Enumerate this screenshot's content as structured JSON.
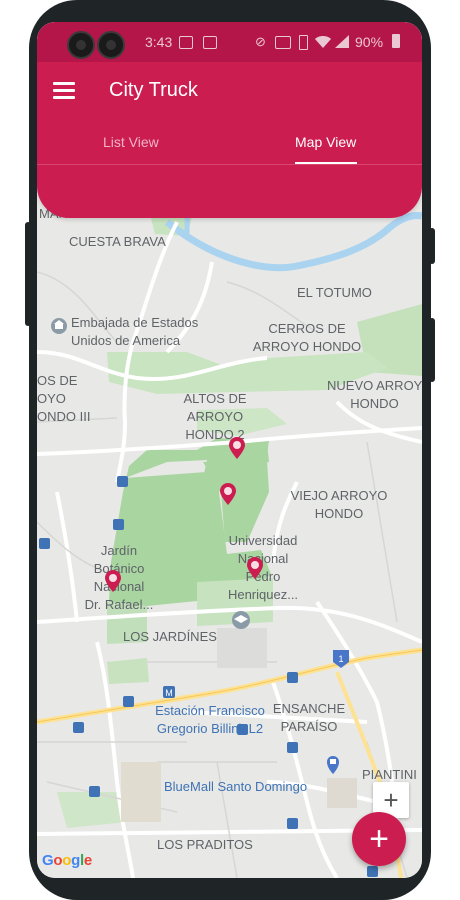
{
  "status_bar": {
    "time": "3:43",
    "battery": "90%",
    "notification_icons": [
      "image-icon",
      "app-icon"
    ],
    "system_icons": [
      "mute-icon",
      "nfc-icon",
      "vibrate-icon",
      "wifi-icon",
      "signal-icon",
      "battery-icon"
    ]
  },
  "app_bar": {
    "title": "City Truck",
    "menu_icon": "hamburger-menu-icon",
    "tabs": [
      {
        "label": "List View",
        "selected": false
      },
      {
        "label": "Map View",
        "selected": true
      }
    ]
  },
  "map": {
    "labels": {
      "manzano": "MANZANO",
      "cuesta_brava": "CUESTA BRAVA",
      "el_totumo": "EL TOTUMO",
      "embajada_1": "Embajada de Estados",
      "embajada_2": "Unidos de America",
      "cerros_1": "CERROS DE",
      "cerros_2": "ARROYO HONDO",
      "left_1": "OS DE",
      "left_2": "OYO",
      "left_3": "ONDO III",
      "altos_1": "ALTOS DE",
      "altos_2": "ARROYO",
      "altos_3": "HONDO 2",
      "nuevo_1": "NUEVO ARROYO",
      "nuevo_2": "HONDO",
      "viejo_1": "VIEJO ARROYO",
      "viejo_2": "HONDO",
      "jardin_1": "Jardín",
      "jardin_2": "Botánico",
      "jardin_3": "Nacional",
      "jardin_4": "Dr. Rafael...",
      "univ_1": "Universidad",
      "univ_2": "Nacional",
      "univ_3": "Pedro",
      "univ_4": "Henriquez...",
      "los_jardines": "LOS JARDÍNES",
      "ensanche_1": "ENSANCHE",
      "ensanche_2": "PARAÍSO",
      "estacion_1": "Estación Francisco",
      "estacion_2": "Gregorio Billini, L2",
      "bluemall": "BlueMall Santo Domingo",
      "piantini": "PIANTINI",
      "los_praditos": "LOS PRADITOS",
      "highway_shield": "1",
      "metro_sign": "M",
      "bus_sign": "▪",
      "google": [
        "G",
        "o",
        "o",
        "g",
        "l",
        "e"
      ]
    },
    "truck_pins": 4,
    "colors": {
      "brand": "#cc1d51",
      "status_bar": "#b5164a",
      "map_bg": "#e8e8e6",
      "park": "#a8d5a0",
      "river": "#aad3f0",
      "pin": "#cc1d51"
    }
  },
  "zoom_in_label": "+",
  "fab_label": "+"
}
